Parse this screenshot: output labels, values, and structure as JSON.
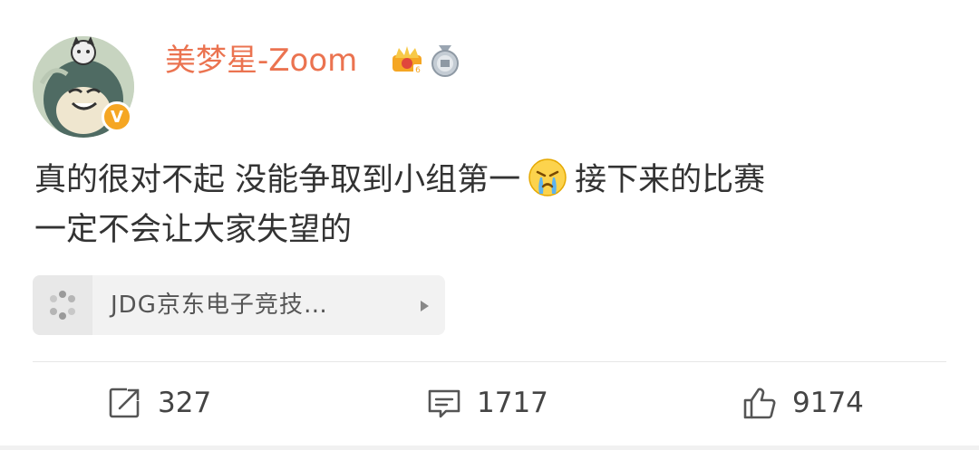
{
  "post": {
    "author": {
      "name": "美梦星-Zoom",
      "verified_mark": "V"
    },
    "content": {
      "line1_a": "真的很对不起 没能争取到小组第一",
      "line1_b": "接下来的比赛",
      "line2": "一定不会让大家失望的",
      "emoji_icon": "crying-emoji"
    },
    "topic": {
      "label": "JDG京东电子竞技…"
    },
    "actions": {
      "repost_count": "327",
      "comment_count": "1717",
      "like_count": "9174"
    }
  },
  "colors": {
    "username": "#eb7350",
    "verified": "#f5a623"
  }
}
